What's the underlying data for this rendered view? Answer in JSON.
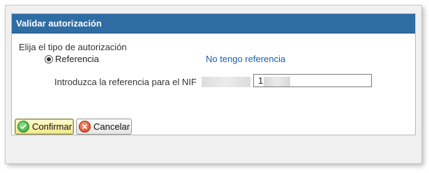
{
  "dialog": {
    "title": "Validar autorización",
    "prompt": "Elija el tipo de autorización",
    "radio_label": "Referencia",
    "no_reference_link": "No tengo referencia",
    "reference_label": "Introduzca la referencia para el NIF",
    "reference_value": "1      D",
    "confirm_label": "Confirmar",
    "cancel_label": "Cancelar"
  },
  "icons": {
    "confirm": "check-circle-icon",
    "cancel": "cancel-x-icon"
  },
  "colors": {
    "header_bg": "#2e6da4",
    "link": "#1a5fa8",
    "confirm_highlight": "#f3e88a"
  }
}
